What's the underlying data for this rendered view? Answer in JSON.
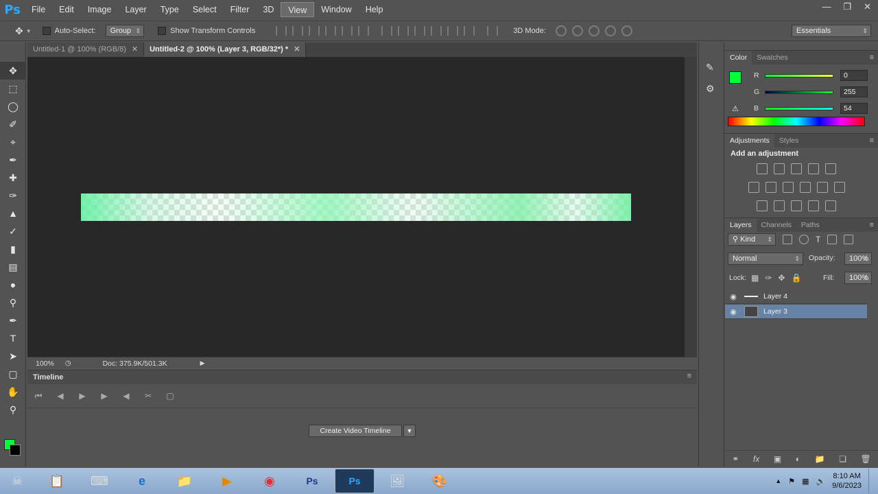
{
  "app": {
    "logo": "Ps"
  },
  "menu": [
    "File",
    "Edit",
    "Image",
    "Layer",
    "Type",
    "Select",
    "Filter",
    "3D",
    "View",
    "Window",
    "Help"
  ],
  "options": {
    "auto_select_label": "Auto-Select:",
    "auto_select_value": "Group",
    "show_transform_label": "Show Transform Controls",
    "mode_3d_label": "3D Mode:",
    "workspace": "Essentials"
  },
  "tabs": [
    {
      "label": "Untitled-1 @ 100% (RGB/8)"
    },
    {
      "label": "Untitled-2 @ 100% (Layer 3, RGB/32*) *"
    }
  ],
  "status": {
    "zoom": "100%",
    "doc": "Doc: 375.9K/501.3K"
  },
  "timeline": {
    "title": "Timeline",
    "create_button": "Create Video Timeline"
  },
  "color_panel": {
    "tabs": [
      "Color",
      "Swatches"
    ],
    "r_label": "R",
    "r_value": "0",
    "g_label": "G",
    "g_value": "255",
    "b_label": "B",
    "b_value": "54",
    "foreground": "#00ff36"
  },
  "adjustments_panel": {
    "tabs": [
      "Adjustments",
      "Styles"
    ],
    "heading": "Add an adjustment"
  },
  "layers_panel": {
    "tabs": [
      "Layers",
      "Channels",
      "Paths"
    ],
    "filter": "Kind",
    "blend_mode": "Normal",
    "opacity_label": "Opacity:",
    "opacity_value": "100%",
    "lock_label": "Lock:",
    "fill_label": "Fill:",
    "fill_value": "100%",
    "layers": [
      {
        "name": "Layer 4"
      },
      {
        "name": "Layer 3"
      }
    ]
  },
  "taskbar": {
    "time": "8:10 AM",
    "date": "9/6/2023"
  }
}
